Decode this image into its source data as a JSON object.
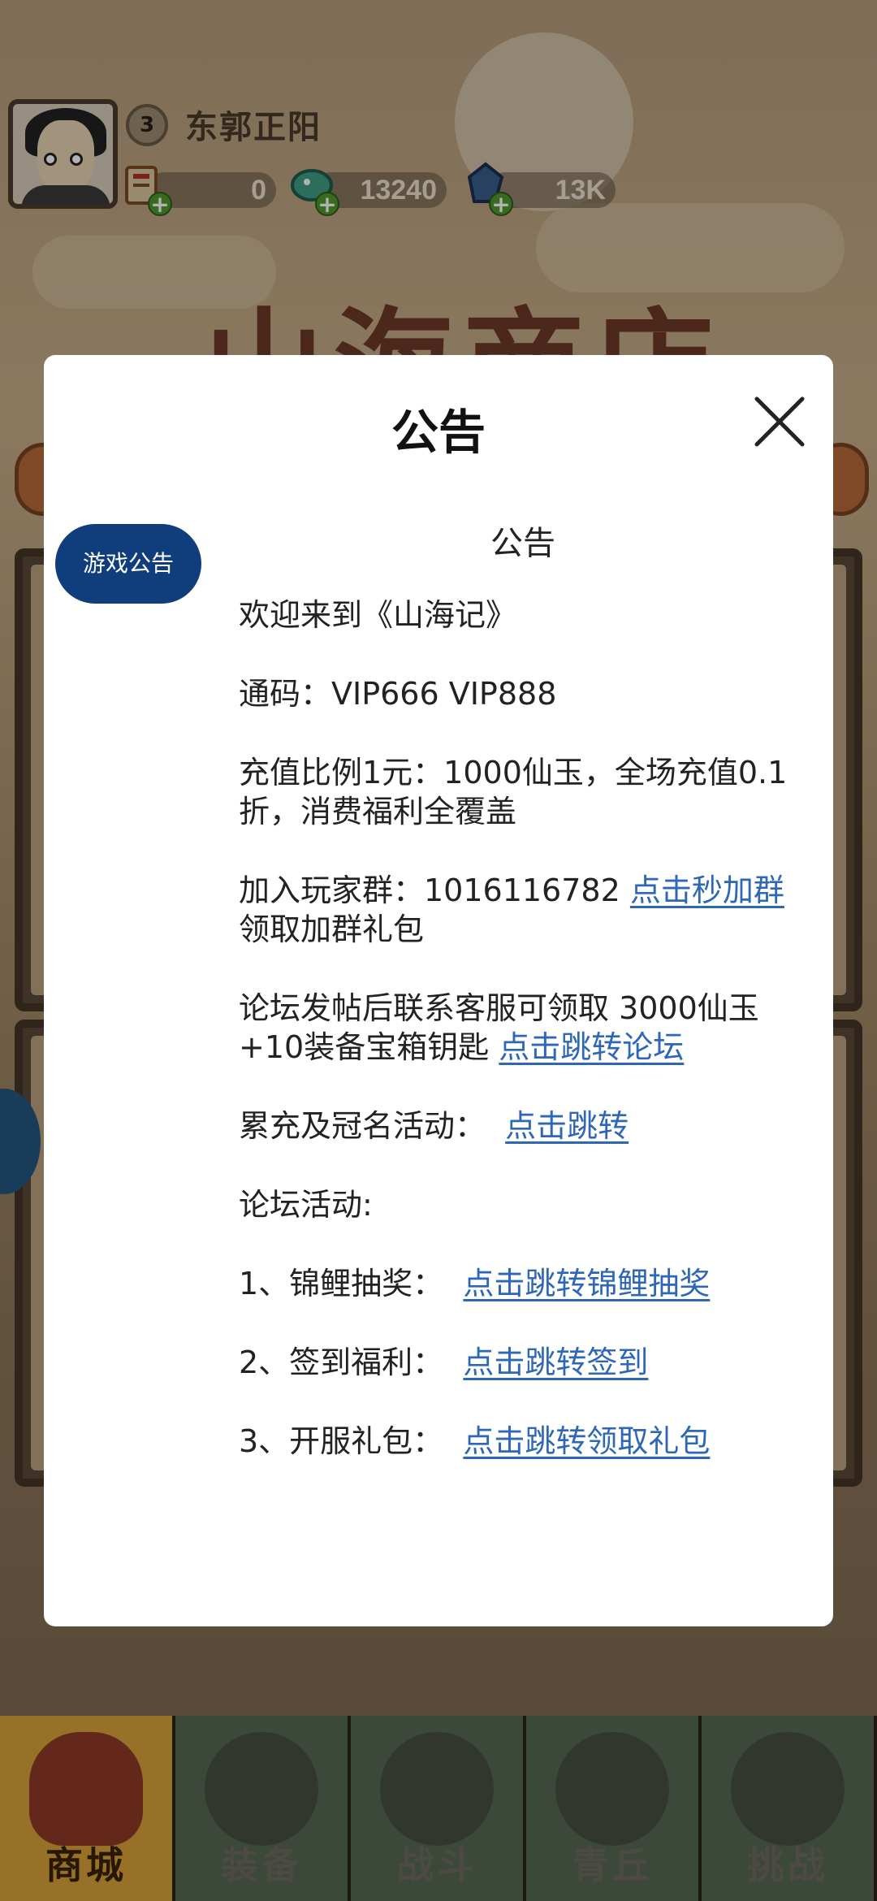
{
  "player": {
    "level": "3",
    "name": "东郭正阳"
  },
  "resources": [
    {
      "icon": "scroll-icon",
      "value": "0"
    },
    {
      "icon": "jade-dragon-icon",
      "value": "13240"
    },
    {
      "icon": "crystal-icon",
      "value": "13K"
    }
  ],
  "background": {
    "banner_text": "山海商店"
  },
  "modal": {
    "title": "公告",
    "side_tab": "游戏公告",
    "heading": "公告",
    "welcome": "欢迎来到《山海记》",
    "codes": "通码：VIP666 VIP888",
    "recharge": "充值比例1元：1000仙玉，全场充值0.1折，消费福利全覆盖",
    "group_prefix": "加入玩家群：1016116782 ",
    "group_link": "点击秒加群",
    "group_suffix": " 领取加群礼包",
    "forum_prefix": "论坛发帖后联系客服可领取 3000仙玉+10装备宝箱钥匙 ",
    "forum_link": "点击跳转论坛",
    "cumulative_prefix": "累充及冠名活动：  ",
    "cumulative_link": "点击跳转",
    "forum_activity": "论坛活动:",
    "item1_prefix": "1、锦鲤抽奖：  ",
    "item1_link": "点击跳转锦鲤抽奖",
    "item2_prefix": "2、签到福利：  ",
    "item2_link": "点击跳转签到",
    "item3_prefix": "3、开服礼包：  ",
    "item3_link": "点击跳转领取礼包"
  },
  "nav": {
    "tabs": [
      {
        "label": "商城",
        "active": true
      },
      {
        "label": "装备",
        "active": false
      },
      {
        "label": "战斗",
        "active": false
      },
      {
        "label": "青丘",
        "active": false
      },
      {
        "label": "挑战",
        "active": false
      }
    ]
  },
  "colors": {
    "modal_bg": "#ffffff",
    "side_tab_bg": "#103d7c",
    "link": "#2f67b7",
    "nav_active": "#d8a23a"
  }
}
